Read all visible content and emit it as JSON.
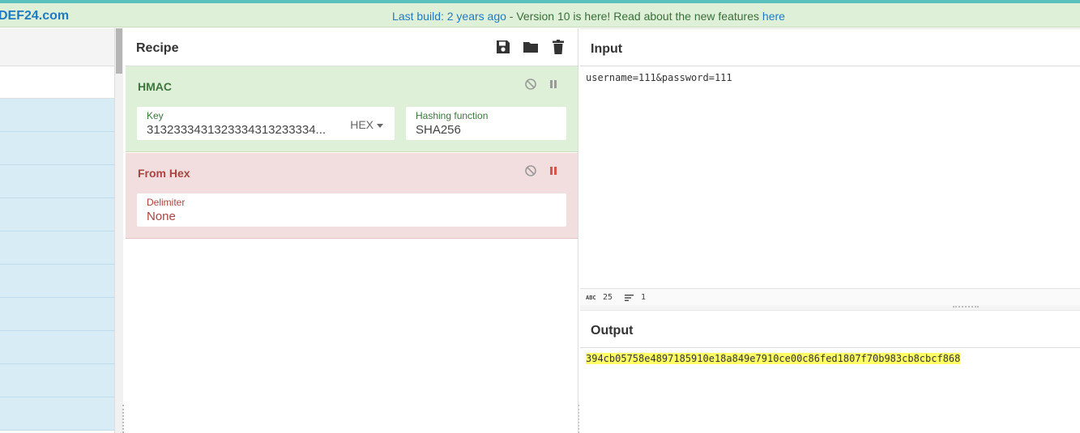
{
  "banner": {
    "logo": "DEF24.com",
    "link_text": "Last build: 2 years ago",
    "message": " - Version 10 is here! Read about the new features ",
    "here_link": "here"
  },
  "recipe": {
    "title": "Recipe",
    "toolbar": [
      "save-icon",
      "folder-icon",
      "trash-icon"
    ],
    "operations": [
      {
        "name": "HMAC",
        "color": "#3c763d",
        "fields": {
          "key_label": "Key",
          "key_value": "3132333431323334313233334...",
          "key_format": "HEX",
          "hash_label": "Hashing function",
          "hash_value": "SHA256"
        },
        "paused": false
      },
      {
        "name": "From Hex",
        "color": "#a94442",
        "fields": {
          "delimiter_label": "Delimiter",
          "delimiter_value": "None"
        },
        "paused": true
      }
    ]
  },
  "input": {
    "title": "Input",
    "text": "username=111&password=111",
    "length_icon": "abc-icon",
    "length": "25",
    "lines_icon": "lines-icon",
    "lines": "1"
  },
  "output": {
    "title": "Output",
    "text": "394cb05758e4897185910e18a849e7910ce00c86fed1807f70b983cb8cbcf868",
    "highlight_color": "#ffff66"
  },
  "colors": {
    "accent": "#1f7ac2",
    "banner_bg": "#dff0d8",
    "ops_item_bg": "#d8ecf6",
    "disabled_op_bg": "#f2dede"
  }
}
